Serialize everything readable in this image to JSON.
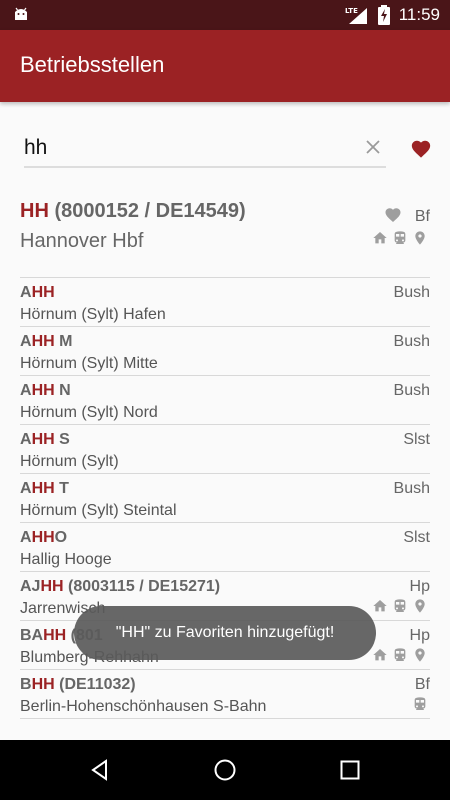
{
  "status_bar": {
    "network": "LTE",
    "time": "11:59"
  },
  "app_bar": {
    "title": "Betriebsstellen"
  },
  "search": {
    "value": "hh",
    "placeholder": ""
  },
  "featured": {
    "code_highlight": "HH",
    "code_rest": " (8000152 / DE14549)",
    "name": "Hannover Hbf",
    "type": "Bf"
  },
  "rows": [
    {
      "pre": "A",
      "hl": "HH",
      "post": "",
      "name": "Hörnum (Sylt) Hafen",
      "type": "Bush"
    },
    {
      "pre": "A",
      "hl": "HH",
      "post": " M",
      "name": "Hörnum (Sylt) Mitte",
      "type": "Bush"
    },
    {
      "pre": "A",
      "hl": "HH",
      "post": " N",
      "name": "Hörnum (Sylt) Nord",
      "type": "Bush"
    },
    {
      "pre": "A",
      "hl": "HH",
      "post": " S",
      "name": "Hörnum (Sylt)",
      "type": "Slst"
    },
    {
      "pre": "A",
      "hl": "HH",
      "post": " T",
      "name": "Hörnum (Sylt) Steintal",
      "type": "Bush"
    },
    {
      "pre": "A",
      "hl": "HH",
      "post": "O",
      "name": "Hallig Hooge",
      "type": "Slst"
    },
    {
      "pre": "AJ",
      "hl": "HH",
      "post": " (8003115 / DE15271)",
      "name": "Jarrenwisch",
      "type": "Hp"
    },
    {
      "pre": "BA",
      "hl": "HH",
      "post": " (801",
      "name": "Blumberg-Rehhahn",
      "type": "Hp"
    },
    {
      "pre": "B",
      "hl": "HH",
      "post": " (DE11032)",
      "name": "Berlin-Hohenschönhausen S-Bahn",
      "type": "Bf"
    }
  ],
  "toast": {
    "message": "\"HH\" zu Favoriten hinzugefügt!"
  },
  "colors": {
    "primary": "#9b2224",
    "status_bar": "#4a1518"
  }
}
